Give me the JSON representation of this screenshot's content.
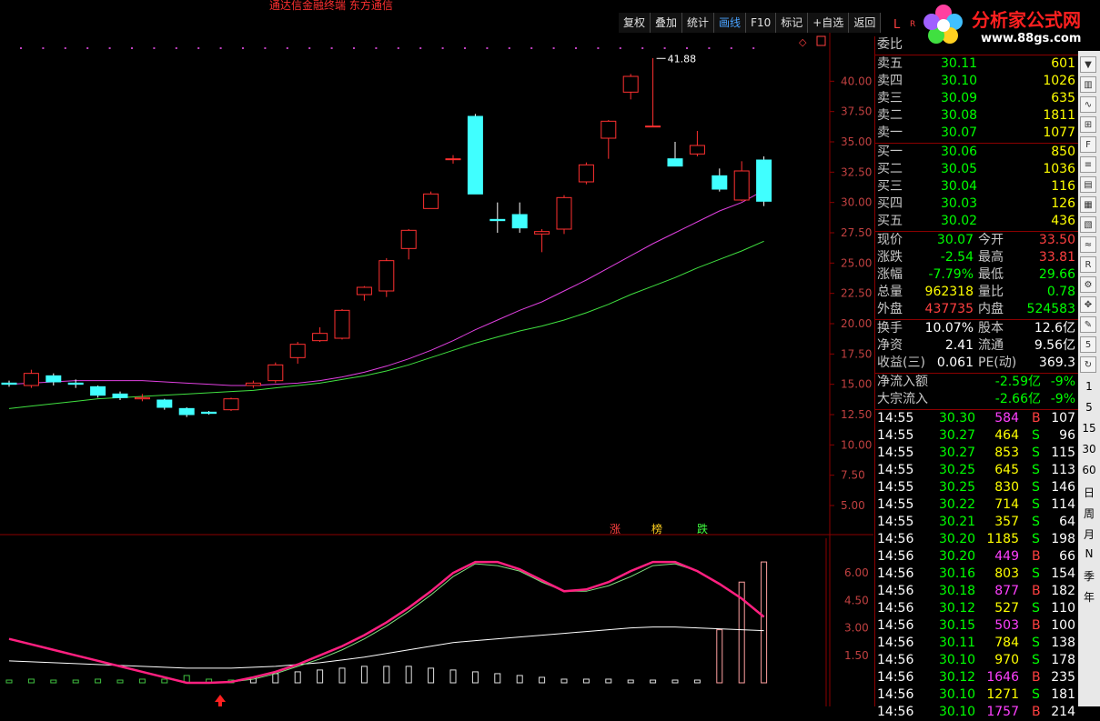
{
  "window": {
    "title": "通达信金融终端  东方通信"
  },
  "toolbar": {
    "items": [
      "复权",
      "叠加",
      "统计",
      "画线",
      "F10",
      "标记",
      "+自选",
      "返回"
    ],
    "active_index": 3
  },
  "logo": {
    "brand": "分析家公式网",
    "url": "www.88gs.com"
  },
  "corner_labels": {
    "L": "L",
    "R": "R"
  },
  "chart_data": [
    {
      "type": "candlestick",
      "y_ticks": [
        "40.00",
        "37.50",
        "35.00",
        "32.50",
        "30.00",
        "27.50",
        "25.00",
        "22.50",
        "20.00",
        "17.50",
        "15.00",
        "12.50",
        "10.00",
        "7.50",
        "5.00"
      ],
      "ylim": [
        3.5,
        42.5
      ],
      "high_label": "41.88",
      "candles": [
        {
          "o": 15.1,
          "c": 15.0,
          "h": 15.3,
          "l": 14.8,
          "up": false
        },
        {
          "o": 14.9,
          "c": 15.9,
          "h": 16.2,
          "l": 14.7,
          "up": true
        },
        {
          "o": 15.7,
          "c": 15.2,
          "h": 15.9,
          "l": 14.9,
          "up": false
        },
        {
          "o": 15.1,
          "c": 15.0,
          "h": 15.4,
          "l": 14.7,
          "up": false
        },
        {
          "o": 14.8,
          "c": 14.1,
          "h": 14.9,
          "l": 13.9,
          "up": false
        },
        {
          "o": 14.2,
          "c": 13.9,
          "h": 14.4,
          "l": 13.7,
          "up": false
        },
        {
          "o": 13.9,
          "c": 13.8,
          "h": 14.2,
          "l": 13.6,
          "up": true
        },
        {
          "o": 13.7,
          "c": 13.1,
          "h": 13.8,
          "l": 12.9,
          "up": false
        },
        {
          "o": 13.0,
          "c": 12.5,
          "h": 13.1,
          "l": 12.3,
          "up": false
        },
        {
          "o": 12.7,
          "c": 12.6,
          "h": 12.8,
          "l": 12.5,
          "up": false
        },
        {
          "o": 12.9,
          "c": 13.8,
          "h": 13.9,
          "l": 12.8,
          "up": true
        },
        {
          "o": 14.9,
          "c": 15.1,
          "h": 15.3,
          "l": 14.7,
          "up": true
        },
        {
          "o": 15.3,
          "c": 16.6,
          "h": 16.8,
          "l": 15.1,
          "up": true
        },
        {
          "o": 17.2,
          "c": 18.3,
          "h": 18.5,
          "l": 16.7,
          "up": true
        },
        {
          "o": 18.6,
          "c": 19.2,
          "h": 19.7,
          "l": 18.5,
          "up": true
        },
        {
          "o": 18.8,
          "c": 21.1,
          "h": 21.2,
          "l": 18.7,
          "up": true
        },
        {
          "o": 22.4,
          "c": 23.0,
          "h": 23.1,
          "l": 21.9,
          "up": true
        },
        {
          "o": 22.7,
          "c": 25.2,
          "h": 25.4,
          "l": 22.2,
          "up": true
        },
        {
          "o": 26.2,
          "c": 27.7,
          "h": 27.8,
          "l": 25.3,
          "up": true
        },
        {
          "o": 29.5,
          "c": 30.7,
          "h": 30.9,
          "l": 29.5,
          "up": true
        },
        {
          "o": 33.6,
          "c": 33.6,
          "h": 33.9,
          "l": 33.2,
          "up": true
        },
        {
          "o": 37.1,
          "c": 30.7,
          "h": 37.3,
          "l": 30.7,
          "up": false
        },
        {
          "o": 28.6,
          "c": 28.5,
          "h": 30.0,
          "l": 27.5,
          "up": false
        },
        {
          "o": 29.0,
          "c": 27.9,
          "h": 30.0,
          "l": 27.5,
          "up": false
        },
        {
          "o": 27.4,
          "c": 27.6,
          "h": 27.8,
          "l": 25.9,
          "up": true
        },
        {
          "o": 27.8,
          "c": 30.4,
          "h": 30.6,
          "l": 27.4,
          "up": true
        },
        {
          "o": 31.7,
          "c": 33.1,
          "h": 33.3,
          "l": 31.5,
          "up": true
        },
        {
          "o": 35.3,
          "c": 36.7,
          "h": 36.8,
          "l": 33.6,
          "up": true
        },
        {
          "o": 39.1,
          "c": 40.4,
          "h": 40.6,
          "l": 38.5,
          "up": true
        },
        {
          "o": 36.3,
          "c": 36.3,
          "h": 41.9,
          "l": 36.3,
          "up": true
        },
        {
          "o": 33.6,
          "c": 33.0,
          "h": 35.0,
          "l": 33.0,
          "up": false
        },
        {
          "o": 34.0,
          "c": 34.7,
          "h": 35.9,
          "l": 33.8,
          "up": true
        },
        {
          "o": 32.2,
          "c": 31.1,
          "h": 32.8,
          "l": 30.9,
          "up": false
        },
        {
          "o": 30.2,
          "c": 32.6,
          "h": 33.4,
          "l": 30.1,
          "up": true
        },
        {
          "o": 33.5,
          "c": 30.1,
          "h": 33.8,
          "l": 29.7,
          "up": false
        }
      ],
      "ma_magenta": [
        15.0,
        15.1,
        15.2,
        15.3,
        15.3,
        15.3,
        15.3,
        15.2,
        15.1,
        15.0,
        14.9,
        14.9,
        15.0,
        15.1,
        15.3,
        15.6,
        16.0,
        16.5,
        17.1,
        17.8,
        18.6,
        19.5,
        20.3,
        21.1,
        21.8,
        22.7,
        23.6,
        24.6,
        25.6,
        26.6,
        27.5,
        28.4,
        29.3,
        30.0,
        31.0
      ],
      "ma_green": [
        13.0,
        13.2,
        13.4,
        13.6,
        13.8,
        13.9,
        14.0,
        14.1,
        14.2,
        14.3,
        14.4,
        14.5,
        14.7,
        14.9,
        15.1,
        15.4,
        15.7,
        16.1,
        16.6,
        17.2,
        17.8,
        18.4,
        18.9,
        19.4,
        19.8,
        20.3,
        20.9,
        21.6,
        22.4,
        23.1,
        23.8,
        24.6,
        25.3,
        26.0,
        26.8
      ],
      "annotations": [
        "涨",
        "榜",
        "跌"
      ]
    },
    {
      "type": "indicator",
      "y_ticks": [
        "6.00",
        "4.50",
        "3.00",
        "1.50"
      ],
      "ylim": [
        0,
        7.2
      ],
      "line_pink": [
        2.4,
        2.1,
        1.8,
        1.5,
        1.2,
        0.9,
        0.6,
        0.3,
        0.0,
        0.0,
        0.05,
        0.3,
        0.6,
        1.0,
        1.5,
        2.0,
        2.6,
        3.3,
        4.1,
        5.0,
        6.0,
        6.6,
        6.6,
        6.2,
        5.6,
        5.0,
        5.1,
        5.5,
        6.1,
        6.6,
        6.6,
        6.1,
        5.4,
        4.6,
        3.6
      ],
      "line_green": [
        2.4,
        2.1,
        1.8,
        1.5,
        1.2,
        0.9,
        0.6,
        0.3,
        0.0,
        0.0,
        0.05,
        0.2,
        0.5,
        0.9,
        1.3,
        1.8,
        2.4,
        3.1,
        3.9,
        4.8,
        5.8,
        6.5,
        6.4,
        6.1,
        5.5,
        5.0,
        5.0,
        5.3,
        5.8,
        6.4,
        6.5,
        6.1,
        5.4,
        4.6,
        3.6
      ],
      "line_white": [
        1.2,
        1.15,
        1.1,
        1.05,
        1.0,
        0.95,
        0.9,
        0.85,
        0.8,
        0.8,
        0.8,
        0.85,
        0.9,
        1.0,
        1.1,
        1.25,
        1.4,
        1.6,
        1.8,
        2.0,
        2.2,
        2.3,
        2.4,
        2.5,
        2.6,
        2.7,
        2.8,
        2.9,
        3.0,
        3.05,
        3.05,
        3.0,
        2.95,
        2.9,
        2.85
      ],
      "bars": [
        0.0,
        0.2,
        0.1,
        0.1,
        0.2,
        0.1,
        0.2,
        0.2,
        0.4,
        0.2,
        0.0,
        0.3,
        0.5,
        0.6,
        0.7,
        0.8,
        0.9,
        0.9,
        0.9,
        0.8,
        0.7,
        0.6,
        0.5,
        0.4,
        0.3,
        0.2,
        0.2,
        0.2,
        0.1,
        0.1,
        0.1,
        0.1,
        2.9,
        5.5,
        6.6
      ]
    }
  ],
  "quote": {
    "weibi": "委比",
    "asks": [
      {
        "label": "卖五",
        "price": "30.11",
        "vol": "601"
      },
      {
        "label": "卖四",
        "price": "30.10",
        "vol": "1026"
      },
      {
        "label": "卖三",
        "price": "30.09",
        "vol": "635"
      },
      {
        "label": "卖二",
        "price": "30.08",
        "vol": "1811"
      },
      {
        "label": "卖一",
        "price": "30.07",
        "vol": "1077"
      }
    ],
    "bids": [
      {
        "label": "买一",
        "price": "30.06",
        "vol": "850"
      },
      {
        "label": "买二",
        "price": "30.05",
        "vol": "1036"
      },
      {
        "label": "买三",
        "price": "30.04",
        "vol": "116"
      },
      {
        "label": "买四",
        "price": "30.03",
        "vol": "126"
      },
      {
        "label": "买五",
        "price": "30.02",
        "vol": "436"
      }
    ],
    "stats": [
      {
        "l1": "现价",
        "v1": "30.07",
        "c1": "green",
        "l2": "今开",
        "v2": "33.50",
        "c2": "red"
      },
      {
        "l1": "涨跌",
        "v1": "-2.54",
        "c1": "green",
        "l2": "最高",
        "v2": "33.81",
        "c2": "red"
      },
      {
        "l1": "涨幅",
        "v1": "-7.79%",
        "c1": "green",
        "l2": "最低",
        "v2": "29.66",
        "c2": "green"
      },
      {
        "l1": "总量",
        "v1": "962318",
        "c1": "yellow",
        "l2": "量比",
        "v2": "0.78",
        "c2": "green"
      },
      {
        "l1": "外盘",
        "v1": "437735",
        "c1": "red",
        "l2": "内盘",
        "v2": "524583",
        "c2": "green"
      }
    ],
    "stats2": [
      {
        "l1": "换手",
        "v1": "10.07%",
        "l2": "股本",
        "v2": "12.6亿"
      },
      {
        "l1": "净资",
        "v1": "2.41",
        "l2": "流通",
        "v2": "9.56亿"
      },
      {
        "l1": "收益(三)",
        "v1": "0.061",
        "l2": "PE(动)",
        "v2": "369.3"
      }
    ],
    "flows": [
      {
        "label": "净流入额",
        "val": "-2.59亿",
        "pct": "-9%"
      },
      {
        "label": "大宗流入",
        "val": "-2.66亿",
        "pct": "-9%"
      }
    ],
    "ticks": [
      {
        "t": "14:55",
        "p": "30.30",
        "v": "584",
        "s": "B",
        "n": "107"
      },
      {
        "t": "14:55",
        "p": "30.27",
        "v": "464",
        "s": "S",
        "n": "96"
      },
      {
        "t": "14:55",
        "p": "30.27",
        "v": "853",
        "s": "S",
        "n": "115"
      },
      {
        "t": "14:55",
        "p": "30.25",
        "v": "645",
        "s": "S",
        "n": "113"
      },
      {
        "t": "14:55",
        "p": "30.25",
        "v": "830",
        "s": "S",
        "n": "146"
      },
      {
        "t": "14:55",
        "p": "30.22",
        "v": "714",
        "s": "S",
        "n": "114"
      },
      {
        "t": "14:55",
        "p": "30.21",
        "v": "357",
        "s": "S",
        "n": "64"
      },
      {
        "t": "14:56",
        "p": "30.20",
        "v": "1185",
        "s": "S",
        "n": "198"
      },
      {
        "t": "14:56",
        "p": "30.20",
        "v": "449",
        "s": "B",
        "n": "66"
      },
      {
        "t": "14:56",
        "p": "30.16",
        "v": "803",
        "s": "S",
        "n": "154"
      },
      {
        "t": "14:56",
        "p": "30.18",
        "v": "877",
        "s": "B",
        "n": "182"
      },
      {
        "t": "14:56",
        "p": "30.12",
        "v": "527",
        "s": "S",
        "n": "110"
      },
      {
        "t": "14:56",
        "p": "30.15",
        "v": "503",
        "s": "B",
        "n": "100"
      },
      {
        "t": "14:56",
        "p": "30.11",
        "v": "784",
        "s": "S",
        "n": "138"
      },
      {
        "t": "14:56",
        "p": "30.10",
        "v": "970",
        "s": "S",
        "n": "178"
      },
      {
        "t": "14:56",
        "p": "30.12",
        "v": "1646",
        "s": "B",
        "n": "235"
      },
      {
        "t": "14:56",
        "p": "30.10",
        "v": "1271",
        "s": "S",
        "n": "181"
      },
      {
        "t": "14:56",
        "p": "30.10",
        "v": "1757",
        "s": "B",
        "n": "214"
      }
    ]
  },
  "sidebar": {
    "icons": [
      "arrow-down-icon",
      "bar-chart-icon",
      "line-chart-icon",
      "candle-chart-icon",
      "f10-icon",
      "kline-icon",
      "book-icon",
      "stats-icon",
      "doc-icon",
      "wave-icon",
      "rsi-icon",
      "gear-icon",
      "move-icon",
      "pen-icon",
      "f5-icon",
      "refresh-icon"
    ],
    "periods": [
      "1",
      "5",
      "15",
      "30",
      "60",
      "日",
      "周",
      "月",
      "N",
      "季",
      "年"
    ]
  },
  "colors": {
    "up": "#ff3030",
    "down": "#40ffff",
    "bg": "#000000",
    "grid": "#8b0000"
  }
}
